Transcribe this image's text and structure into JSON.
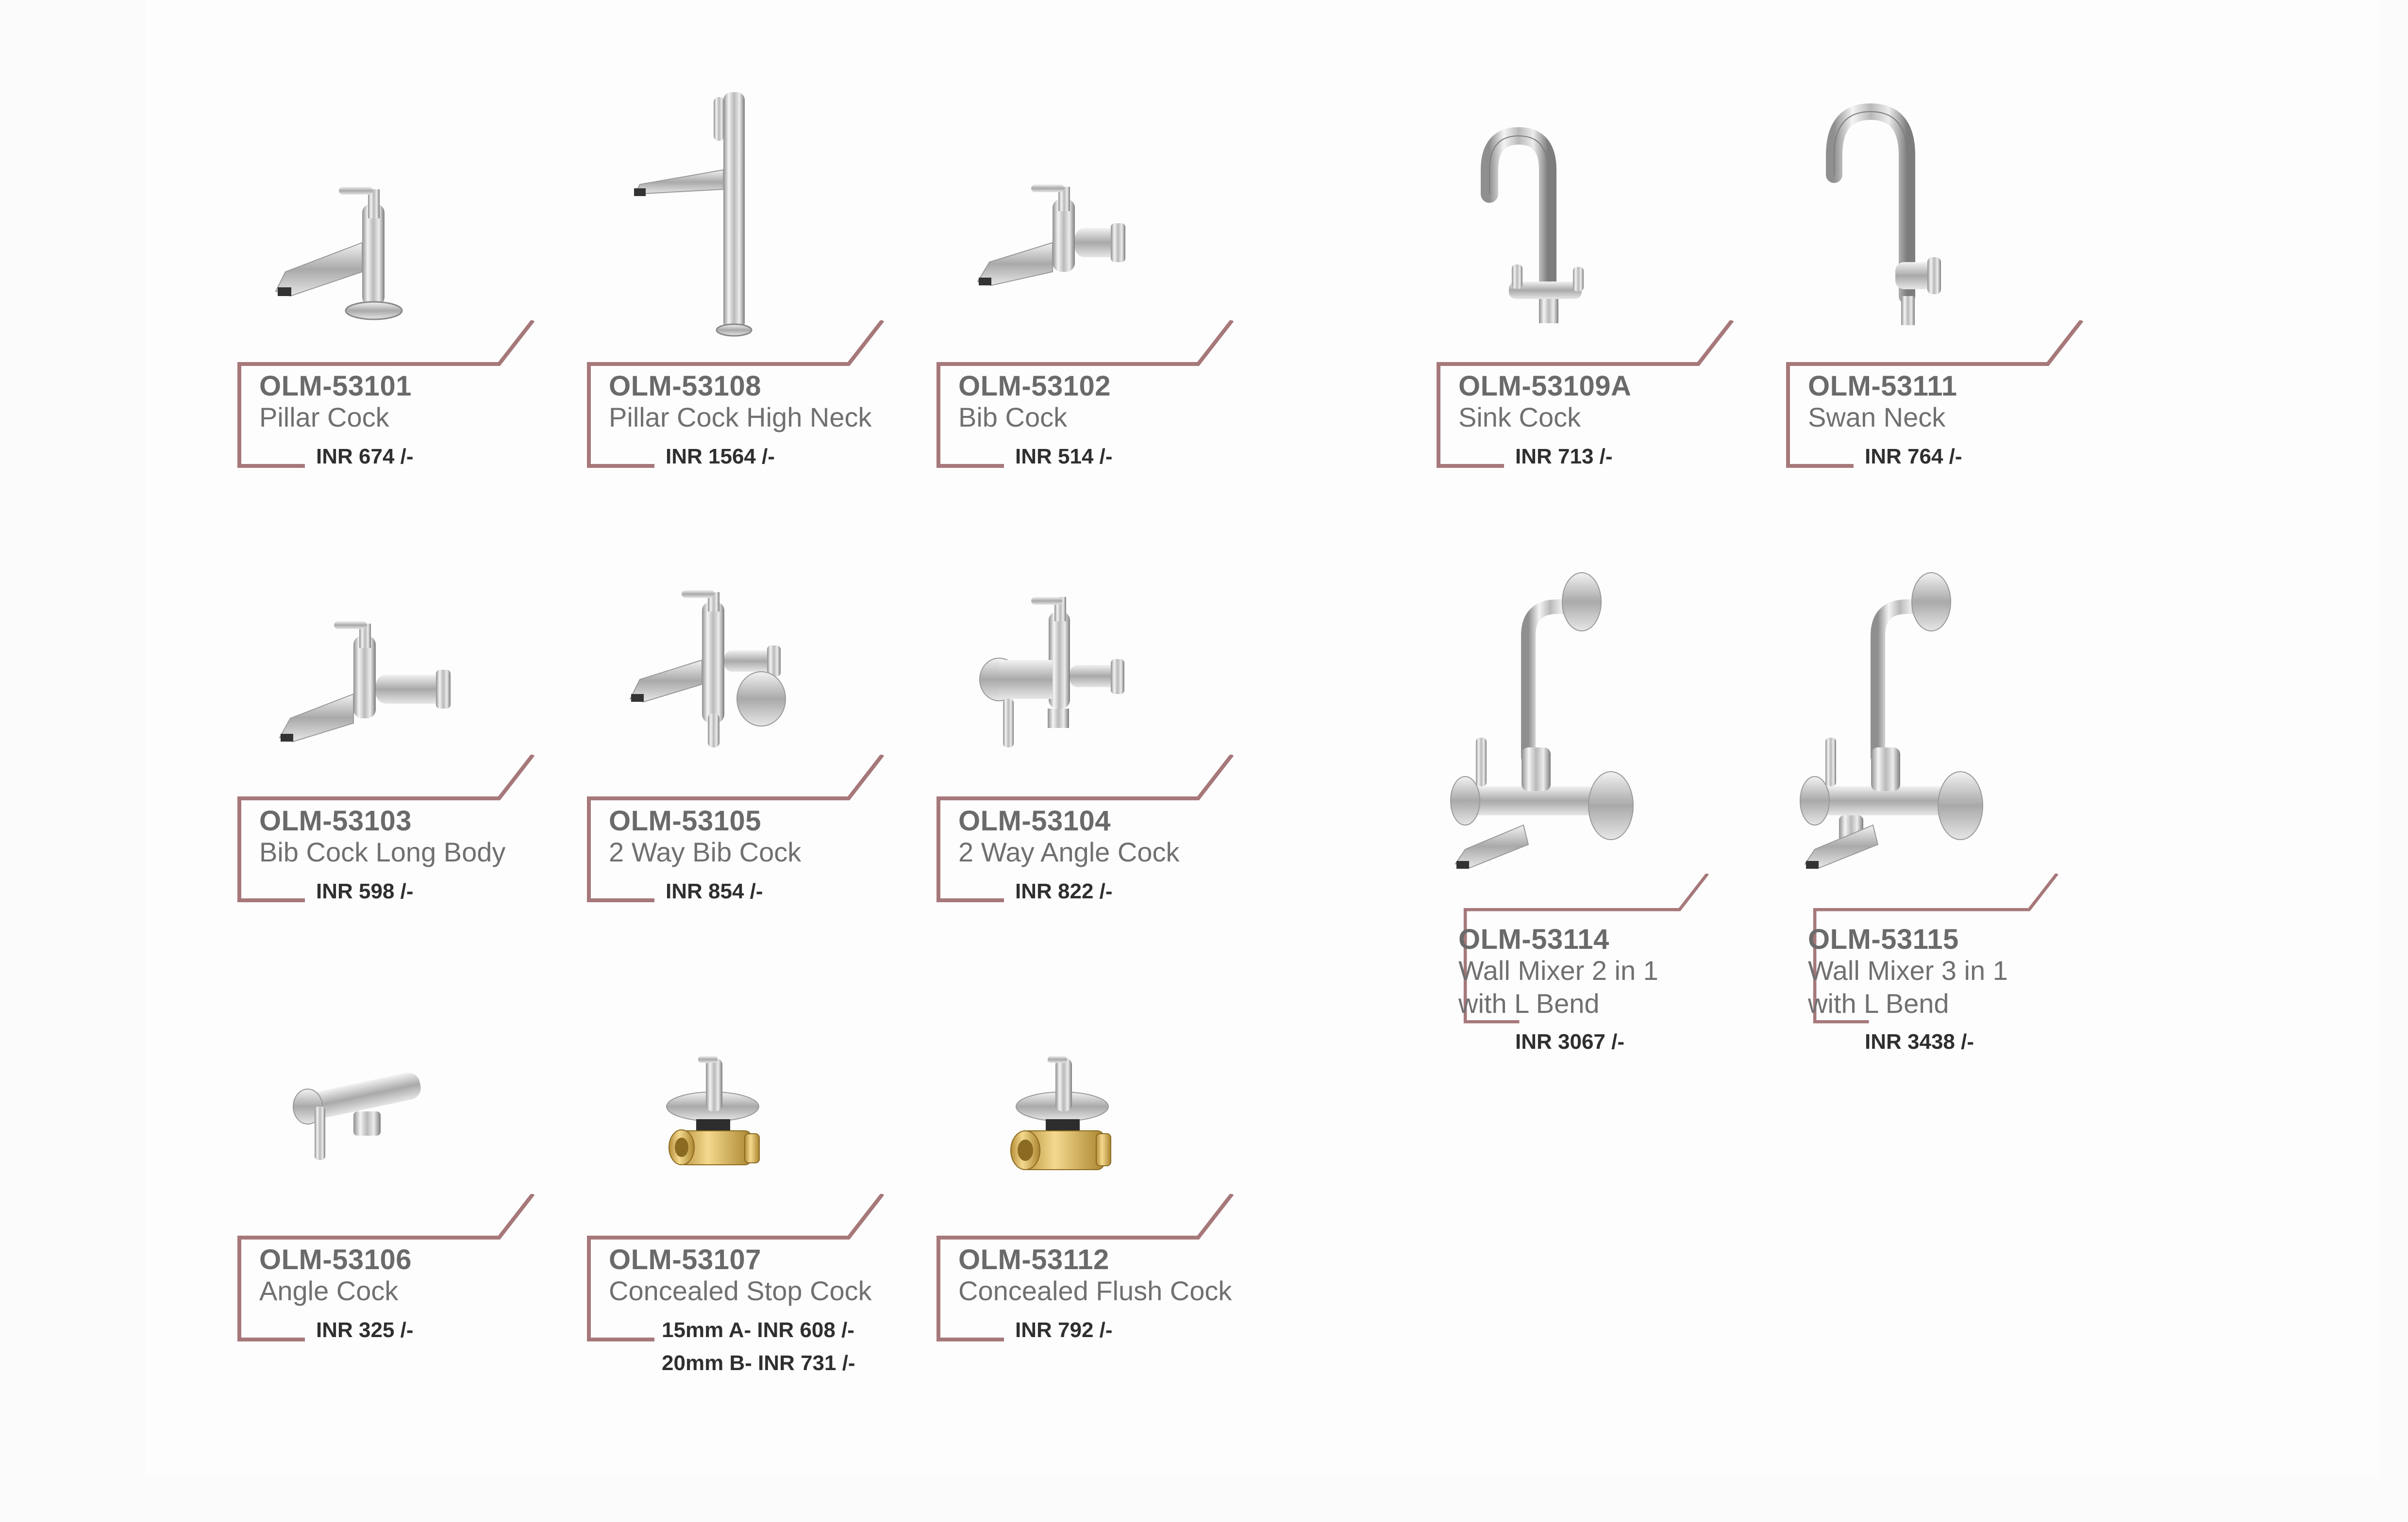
{
  "colors": {
    "frame": "#a6787a",
    "chrome": "#c8c8c8",
    "brass": "#d9b45a",
    "code_text": "#6a6a6a",
    "price_text": "#2f2f2f"
  },
  "products": [
    {
      "code": "OLM-53101",
      "name": "Pillar Cock",
      "price": "INR 674 /-",
      "icon": "pillar-cock-icon"
    },
    {
      "code": "OLM-53108",
      "name": "Pillar Cock High Neck",
      "price": "INR 1564 /-",
      "icon": "pillar-cock-high-neck-icon"
    },
    {
      "code": "OLM-53102",
      "name": "Bib Cock",
      "price": "INR 514 /-",
      "icon": "bib-cock-icon"
    },
    {
      "code": "OLM-53109A",
      "name": "Sink Cock",
      "price": "INR 713 /-",
      "icon": "sink-cock-icon"
    },
    {
      "code": "OLM-53111",
      "name": "Swan Neck",
      "price": "INR 764 /-",
      "icon": "swan-neck-icon"
    },
    {
      "code": "OLM-53103",
      "name": "Bib Cock Long Body",
      "price": "INR 598 /-",
      "icon": "bib-cock-long-body-icon"
    },
    {
      "code": "OLM-53105",
      "name": "2 Way Bib Cock",
      "price": "INR 854 /-",
      "icon": "two-way-bib-cock-icon"
    },
    {
      "code": "OLM-53104",
      "name": "2 Way Angle Cock",
      "price": "INR 822 /-",
      "icon": "two-way-angle-cock-icon"
    },
    {
      "code": "OLM-53114",
      "name_line1": "Wall Mixer 2 in 1",
      "name_line2": "with L Bend",
      "price": "INR 3067 /-",
      "icon": "wall-mixer-2-in-1-icon"
    },
    {
      "code": "OLM-53115",
      "name_line1": "Wall Mixer 3 in 1",
      "name_line2": "with L Bend",
      "price": "INR 3438 /-",
      "icon": "wall-mixer-3-in-1-icon"
    },
    {
      "code": "OLM-53106",
      "name": "Angle Cock",
      "price": "INR 325 /-",
      "icon": "angle-cock-icon"
    },
    {
      "code": "OLM-53107",
      "name": "Concealed Stop Cock",
      "price_a": "15mm A- INR 608 /-",
      "price_b": "20mm B- INR 731 /-",
      "icon": "concealed-stop-cock-icon"
    },
    {
      "code": "OLM-53112",
      "name": "Concealed Flush Cock",
      "price": "INR 792 /-",
      "icon": "concealed-flush-cock-icon"
    }
  ]
}
